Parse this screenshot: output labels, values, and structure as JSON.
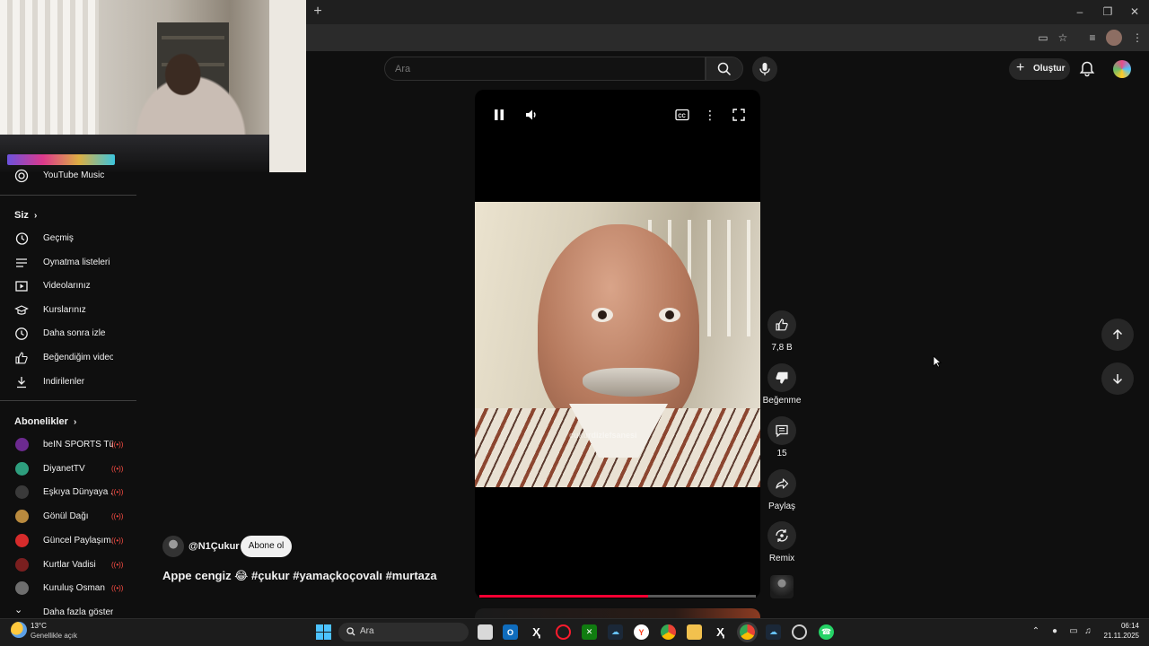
{
  "browser": {
    "new_tab_symbol": "+"
  },
  "masthead": {
    "search_placeholder": "Ara",
    "create_label": "Oluştur"
  },
  "sidebar": {
    "top_item": "YouTube Music",
    "you_heading": "Siz",
    "you_items": [
      {
        "label": "Geçmiş",
        "icon": "history-icon"
      },
      {
        "label": "Oynatma listeleri",
        "icon": "playlists-icon"
      },
      {
        "label": "Videolarınız",
        "icon": "your-videos-icon"
      },
      {
        "label": "Kurslarınız",
        "icon": "courses-icon"
      },
      {
        "label": "Daha sonra izle",
        "icon": "watch-later-icon"
      },
      {
        "label": "Beğendiğim videolar",
        "icon": "liked-videos-icon"
      },
      {
        "label": "İndirilenler",
        "icon": "downloads-icon"
      }
    ],
    "subs_heading": "Abonelikler",
    "subscriptions": [
      {
        "label": "beIN SPORTS Tü...",
        "color": "#6c2a8f"
      },
      {
        "label": "DiyanetTV",
        "color": "#2e9e7e"
      },
      {
        "label": "Eşkıya Dünyaya ...",
        "color": "#3a3a3a"
      },
      {
        "label": "Gönül Dağı",
        "color": "#b98a3e"
      },
      {
        "label": "Güncel Paylaşım...",
        "color": "#d62b2b"
      },
      {
        "label": "Kurtlar Vadisi",
        "color": "#7a1f1f"
      },
      {
        "label": "Kuruluş Osman",
        "color": "#6e6e6e"
      }
    ],
    "show_more": "Daha fazla göster"
  },
  "short": {
    "channel": "@N1Çukur",
    "subscribe_label": "Abone ol",
    "title": "Appe cengiz 😂 #çukur #yamaçkoçovalı #murtaza",
    "watermark": "cukurdizlefsanesi",
    "progress": 0.61,
    "likes": "7,8 B",
    "dislike_label": "Beğenme",
    "comments": "15",
    "share_label": "Paylaş",
    "remix_label": "Remix"
  },
  "taskbar": {
    "weather_temp": "13°C",
    "weather_desc": "Genellikle açık",
    "search_label": "Ara",
    "time": "06:14",
    "date": "21.11.2025"
  },
  "colors": {
    "accent_red": "#ff0033",
    "windows_blue": "#4cc2ff"
  }
}
